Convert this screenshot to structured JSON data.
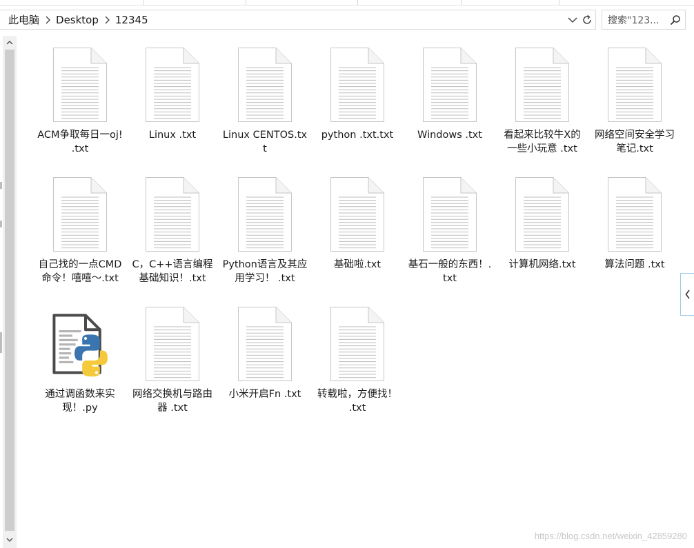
{
  "address_bar": {
    "crumbs": [
      "此电脑",
      "Desktop",
      "12345"
    ]
  },
  "search": {
    "placeholder": "搜索\"123..."
  },
  "files": [
    {
      "label": "ACM争取每日一oj! .txt",
      "icon": "text-file-icon"
    },
    {
      "label": "Linux .txt",
      "icon": "text-file-icon"
    },
    {
      "label": "Linux CENTOS.txt",
      "icon": "text-file-icon"
    },
    {
      "label": "python .txt.txt",
      "icon": "text-file-icon"
    },
    {
      "label": "Windows .txt",
      "icon": "text-file-icon"
    },
    {
      "label": "看起来比较牛X的一些小玩意 .txt",
      "icon": "text-file-icon"
    },
    {
      "label": "网络空间安全学习笔记.txt",
      "icon": "text-file-icon"
    },
    {
      "label": "自己找的一点CMD命令！嘻嘻～.txt",
      "icon": "text-file-icon"
    },
    {
      "label": "C，C++语言编程基础知识！.txt",
      "icon": "text-file-icon"
    },
    {
      "label": "Python语言及其应用学习！ .txt",
      "icon": "text-file-icon"
    },
    {
      "label": "基础啦.txt",
      "icon": "text-file-icon"
    },
    {
      "label": "基石一般的东西！.txt",
      "icon": "text-file-icon"
    },
    {
      "label": "计算机网络.txt",
      "icon": "text-file-icon"
    },
    {
      "label": "算法问题 .txt",
      "icon": "text-file-icon"
    },
    {
      "label": "通过调函数来实现！.py",
      "icon": "python-file-icon"
    },
    {
      "label": "网络交换机与路由器 .txt",
      "icon": "text-file-icon"
    },
    {
      "label": "小米开启Fn .txt",
      "icon": "text-file-icon"
    },
    {
      "label": "转载啦，方便找！ .txt",
      "icon": "text-file-icon"
    }
  ],
  "watermark": "https://blog.csdn.net/weixin_42859280",
  "colors": {
    "python_blue": "#3a75b0",
    "python_yellow": "#f5c93c",
    "scroll_thumb": "#cdcdcd",
    "side_tab_border": "#9cc7e8"
  }
}
